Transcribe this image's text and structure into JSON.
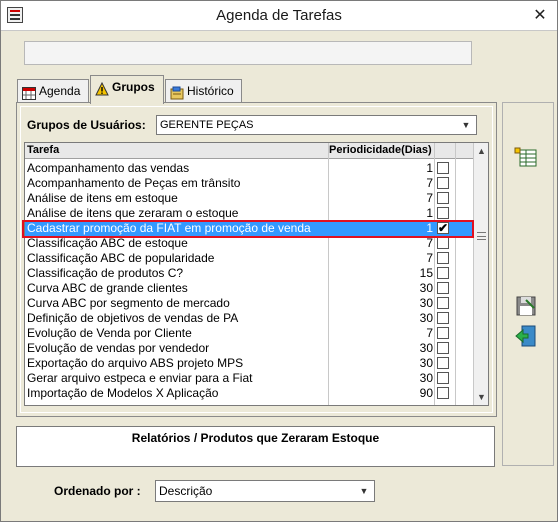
{
  "window": {
    "title": "Agenda de Tarefas",
    "close": "✕"
  },
  "tabs": [
    {
      "label": "Agenda"
    },
    {
      "label": "Grupos"
    },
    {
      "label": "Histórico"
    }
  ],
  "groups": {
    "label": "Grupos de Usuários:",
    "value": "GERENTE PEÇAS"
  },
  "grid": {
    "col_task": "Tarefa",
    "col_period": "Periodicidade(Dias)",
    "rows": [
      {
        "task": "Acompanhamento das vendas",
        "period": "1",
        "checked": false
      },
      {
        "task": "Acompanhamento de Peças em trânsito",
        "period": "7",
        "checked": false
      },
      {
        "task": "Análise de itens em estoque",
        "period": "7",
        "checked": false
      },
      {
        "task": "Análise de itens que zeraram o estoque",
        "period": "1",
        "checked": false
      },
      {
        "task": "Cadastrar promoção da FIAT em promoção de venda",
        "period": "1",
        "checked": true
      },
      {
        "task": "Classificação ABC de estoque",
        "period": "7",
        "checked": false
      },
      {
        "task": "Classificação ABC de popularidade",
        "period": "7",
        "checked": false
      },
      {
        "task": "Classificação de produtos C?",
        "period": "15",
        "checked": false
      },
      {
        "task": "Curva ABC de grande clientes",
        "period": "30",
        "checked": false
      },
      {
        "task": "Curva ABC por segmento de mercado",
        "period": "30",
        "checked": false
      },
      {
        "task": "Definição de objetivos de vendas de PA",
        "period": "30",
        "checked": false
      },
      {
        "task": "Evolução de Venda por Cliente",
        "period": "7",
        "checked": false
      },
      {
        "task": "Evolução de vendas por vendedor",
        "period": "30",
        "checked": false
      },
      {
        "task": "Exportação do arquivo ABS projeto MPS",
        "period": "30",
        "checked": false
      },
      {
        "task": "Gerar arquivo estpeca e enviar para a Fiat",
        "period": "30",
        "checked": false
      },
      {
        "task": "Importação de Modelos X Aplicação",
        "period": "90",
        "checked": false
      }
    ]
  },
  "report": {
    "title": "Relatórios / Produtos que Zeraram Estoque"
  },
  "order": {
    "label": "Ordenado por :",
    "value": "Descrição"
  },
  "colors": {
    "selection": "#3399ff",
    "highlight_border": "#e01020"
  }
}
